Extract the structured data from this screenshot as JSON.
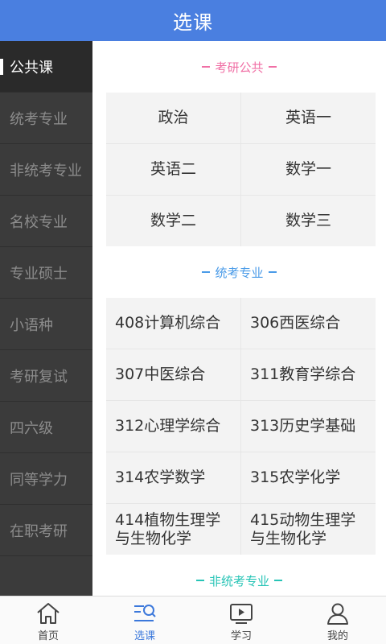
{
  "header": {
    "title": "选课"
  },
  "sidebar": {
    "items": [
      {
        "label": "公共课",
        "active": true
      },
      {
        "label": "统考专业"
      },
      {
        "label": "非统考专业"
      },
      {
        "label": "名校专业"
      },
      {
        "label": "专业硕士"
      },
      {
        "label": "小语种"
      },
      {
        "label": "考研复试"
      },
      {
        "label": "四六级"
      },
      {
        "label": "同等学力"
      },
      {
        "label": "在职考研"
      }
    ]
  },
  "sections": [
    {
      "title": "考研公共",
      "color": "#f06fa5",
      "courses": [
        "政治",
        "英语一",
        "英语二",
        "数学一",
        "数学二",
        "数学三"
      ]
    },
    {
      "title": "统考专业",
      "color": "#4a9be8",
      "courses": [
        "408计算机综合",
        "306西医综合",
        "307中医综合",
        "311教育学综合",
        "312心理学综合",
        "313历史学基础",
        "314农学数学",
        "315农学化学",
        "414植物生理学与生物化学",
        "415动物生理学与生物化学"
      ]
    },
    {
      "title": "非统考专业",
      "color": "#27c4b6",
      "courses": []
    }
  ],
  "tabbar": {
    "items": [
      {
        "label": "首页",
        "icon": "home-icon"
      },
      {
        "label": "选课",
        "icon": "course-select-icon",
        "active": true
      },
      {
        "label": "学习",
        "icon": "play-video-icon"
      },
      {
        "label": "我的",
        "icon": "user-icon"
      }
    ]
  },
  "colors": {
    "header": "#4a7fe0",
    "sidebar": "#3b3b3b",
    "active_tab": "#3b78db"
  }
}
